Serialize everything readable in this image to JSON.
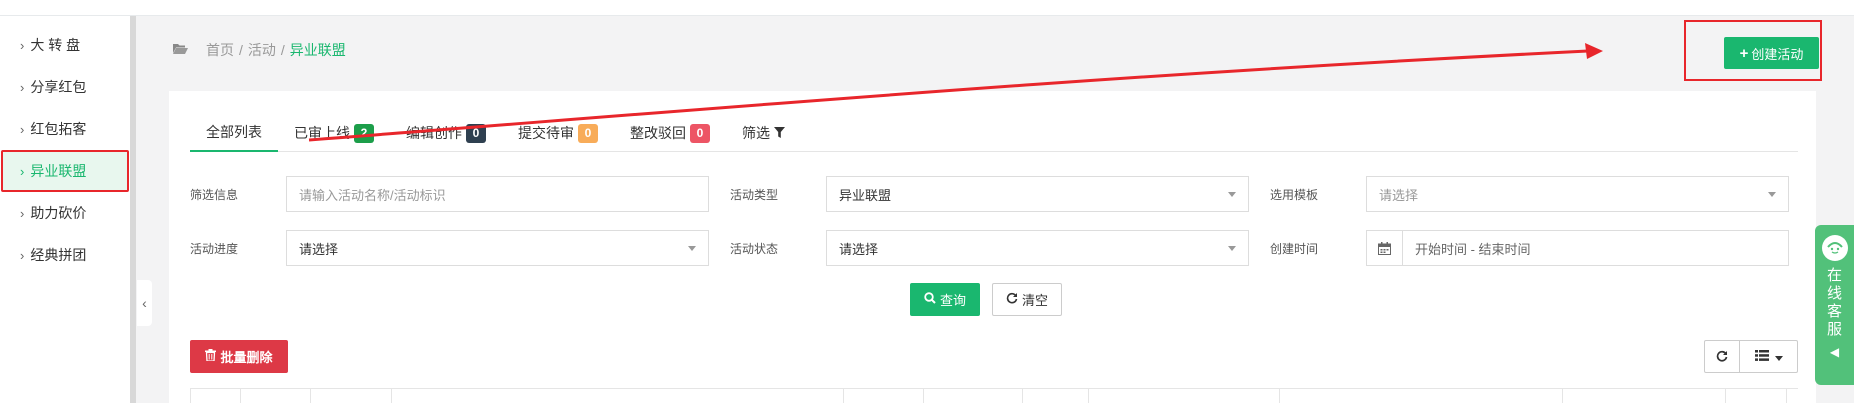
{
  "sidebar": {
    "items": [
      {
        "label": "大 转 盘",
        "active": false
      },
      {
        "label": "分享红包",
        "active": false
      },
      {
        "label": "红包拓客",
        "active": false
      },
      {
        "label": "异业联盟",
        "active": true
      },
      {
        "label": "助力砍价",
        "active": false
      },
      {
        "label": "经典拼团",
        "active": false
      }
    ],
    "chevron": "›",
    "collapse_icon": "‹"
  },
  "breadcrumb": {
    "folder_icon": "folder-open-icon",
    "home": "首页",
    "level1": "活动",
    "current": "异业联盟",
    "sep": "/"
  },
  "header": {
    "create_label": "创建活动",
    "create_icon": "plus-icon"
  },
  "tabs": [
    {
      "label": "全部列表",
      "badge": null
    },
    {
      "label": "已审上线",
      "badge": "2",
      "badge_color": "#1c9e4a"
    },
    {
      "label": "编辑创作",
      "badge": "0",
      "badge_color": "#2f4050"
    },
    {
      "label": "提交待审",
      "badge": "0",
      "badge_color": "#f8ac59"
    },
    {
      "label": "整改驳回",
      "badge": "0",
      "badge_color": "#ed5565"
    },
    {
      "label": "筛选",
      "badge": null,
      "icon": "filter-icon"
    }
  ],
  "filters": {
    "info_label": "筛选信息",
    "info_placeholder": "请输入活动名称/活动标识",
    "type_label": "活动类型",
    "type_value": "异业联盟",
    "template_label": "选用模板",
    "template_value": "请选择",
    "progress_label": "活动进度",
    "progress_value": "请选择",
    "status_label": "活动状态",
    "status_value": "请选择",
    "created_label": "创建时间",
    "created_placeholder": "开始时间 - 结束时间"
  },
  "actions": {
    "query_label": "查询",
    "clear_label": "清空",
    "batch_delete_label": "批量删除"
  },
  "kefu": {
    "label": "在线客服"
  },
  "colors": {
    "accent": "#1ab76f",
    "danger": "#dd3946",
    "annotation": "#e8262b"
  }
}
